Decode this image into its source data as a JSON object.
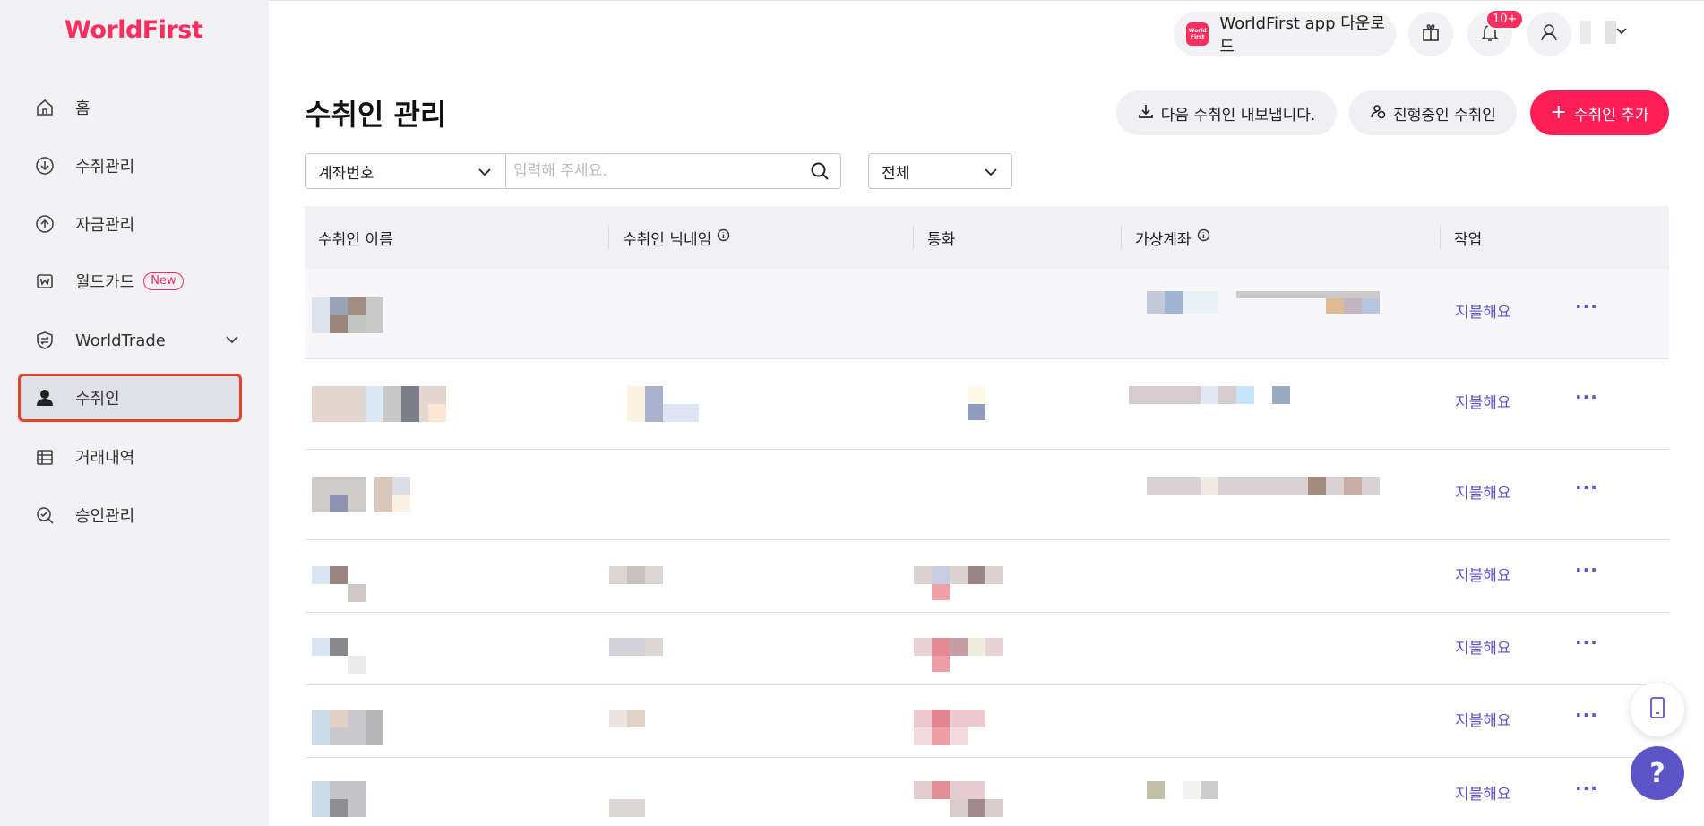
{
  "brand": {
    "logo_text": "WorldFirst",
    "accent": "#ff2e5e",
    "link_color": "#5b55c8"
  },
  "sidebar": {
    "items": [
      {
        "label": "홈",
        "icon": "home-icon"
      },
      {
        "label": "수취관리",
        "icon": "download-circle-icon"
      },
      {
        "label": "자금관리",
        "icon": "upload-circle-icon"
      },
      {
        "label": "월드카드",
        "icon": "card-w-icon",
        "badge": "New"
      },
      {
        "label": "WorldTrade",
        "icon": "trade-shield-icon"
      },
      {
        "label": "수취인",
        "icon": "person-icon",
        "active": true
      },
      {
        "label": "거래내역",
        "icon": "list-table-icon"
      },
      {
        "label": "승인관리",
        "icon": "approval-search-icon"
      }
    ]
  },
  "topbar": {
    "app_download": "WorldFirst app 다운로드",
    "app_logo_text": "World First",
    "notification_count": "10+"
  },
  "main": {
    "title": "수취인 관리",
    "actions": {
      "export": "다음 수취인 내보냅니다.",
      "in_progress": "진행중인 수취인",
      "add": "수취인 추가",
      "add_prefix": "+"
    },
    "filters": {
      "field_select": "계좌번호",
      "search_placeholder": "입력해 주세요.",
      "status_select": "전체"
    },
    "table": {
      "columns": [
        "수취인 이름",
        "수취인 닉네임",
        "통화",
        "가상계좌",
        "작업"
      ],
      "row_action": "지불해요",
      "row_more": "···",
      "row_count": 7
    }
  }
}
